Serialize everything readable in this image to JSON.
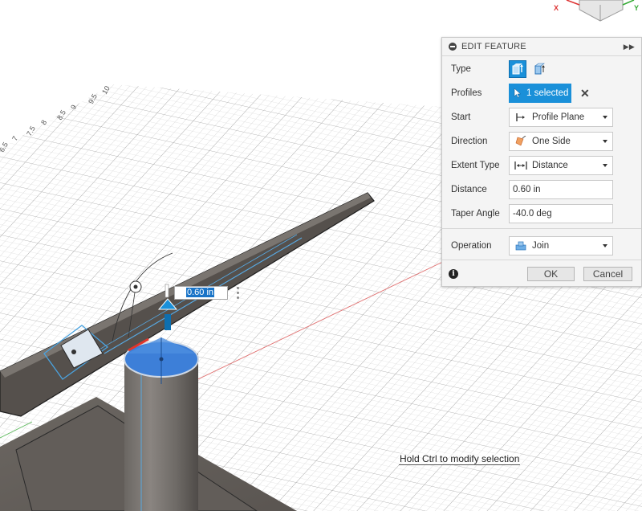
{
  "panel": {
    "title": "EDIT FEATURE",
    "type_label": "Type",
    "profiles_label": "Profiles",
    "profiles_value": "1 selected",
    "start_label": "Start",
    "start_value": "Profile Plane",
    "direction_label": "Direction",
    "direction_value": "One Side",
    "extent_label": "Extent Type",
    "extent_value": "Distance",
    "distance_label": "Distance",
    "distance_value": "0.60 in",
    "taper_label": "Taper Angle",
    "taper_value": "-40.0 deg",
    "operation_label": "Operation",
    "operation_value": "Join",
    "ok_label": "OK",
    "cancel_label": "Cancel"
  },
  "canvas": {
    "distance_manipulator_value": "0.60 in",
    "hint": "Hold Ctrl to modify selection",
    "ruler_ticks": [
      "10",
      "9.5",
      "9",
      "8.5",
      "8",
      "7.5",
      "7",
      "6.5"
    ],
    "viewcube_x": "X",
    "viewcube_y": "Y"
  },
  "colors": {
    "accent": "#1a90d9",
    "selection_blue": "#3d7fd8",
    "body_gray": "#5f5a56"
  }
}
